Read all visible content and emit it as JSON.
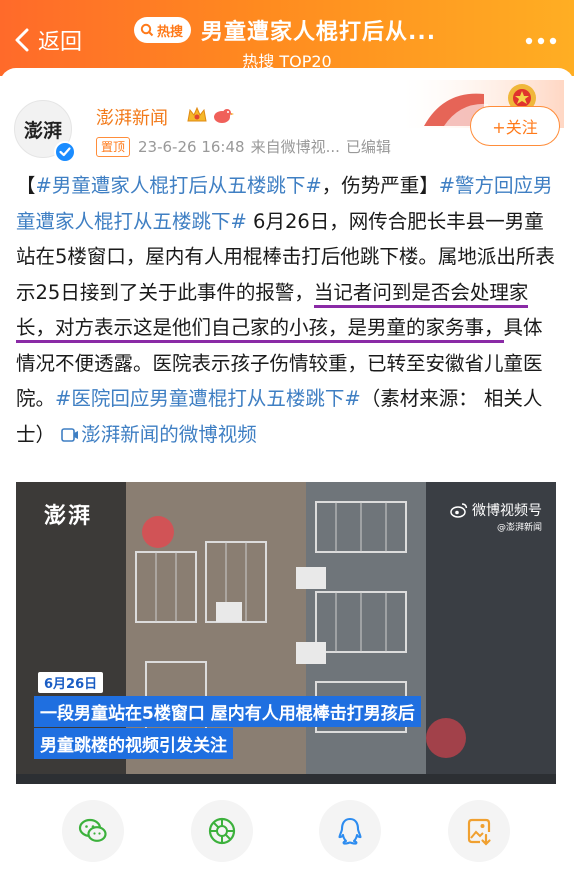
{
  "header": {
    "back_label": "返回",
    "hot_badge": "热搜",
    "title": "男童遭家人棍打后从...",
    "subtitle": "热搜 TOP20",
    "colors": {
      "gradient_start": "#ff6a2a",
      "gradient_end": "#ffae23"
    }
  },
  "post": {
    "account": "澎湃新闻",
    "avatar_text": "澎湃",
    "follow_label": "+关注",
    "pinned": "置顶",
    "timestamp": "23-6-26 16:48",
    "source": "来自微博视...",
    "edited": "已编辑",
    "text": {
      "p1": "【",
      "tag1": "#男童遭家人棍打后从五楼跳下#",
      "p2": "，伤势严重】",
      "tag2": "#警方回应男童遭家人棍打从五楼跳下#",
      "p3": " 6月26日，网传合肥长丰县一男童站在5楼窗口，屋内有人用棍棒击打后他跳下楼。属地派出所表示25日接到了关于此事件的报警，",
      "u1": "当记者问到是否会处理家长，对方表示这",
      "u2": "是他们自己家的小孩，是男童的家务事，",
      "p4": "具体情况不便透露。医院表示孩子伤情较重，已转至安徽省儿童医院。",
      "tag3": "#医院回应男童遭棍打从五楼跳下#",
      "p5": "（素材来源： 相关人士）",
      "video_link": "澎湃新闻的微博视频"
    },
    "colors": {
      "account": "#f27a1a",
      "link": "#3f7fc3",
      "underline": "#8a2aa6"
    }
  },
  "video": {
    "logo": "澎湃",
    "weibo_video": "微博视频号",
    "weibo_sub": "@澎湃新闻",
    "date_tag": "6月26日",
    "caption1": "一段男童站在5楼窗口 屋内有人用棍棒击打男孩后",
    "caption2": "男童跳楼的视频引发关注"
  },
  "share": {
    "icons": [
      "wechat-icon",
      "moments-icon",
      "qq-icon",
      "save-image-icon"
    ]
  }
}
